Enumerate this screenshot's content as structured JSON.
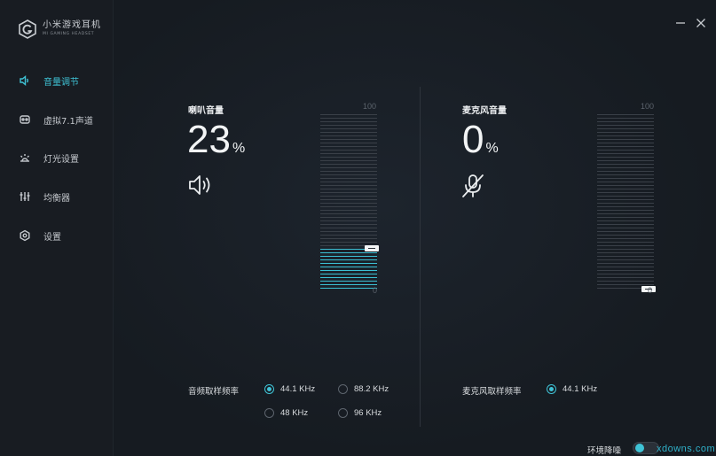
{
  "brand": {
    "name": "小米游戏耳机",
    "subtitle": "MI GAMING HEADSET"
  },
  "sidebar": {
    "items": [
      {
        "label": "音量调节",
        "icon": "speaker-icon",
        "active": true
      },
      {
        "label": "虚拟7.1声道",
        "icon": "virtual-surround-icon",
        "active": false
      },
      {
        "label": "灯光设置",
        "icon": "light-icon",
        "active": false
      },
      {
        "label": "均衡器",
        "icon": "equalizer-icon",
        "active": false
      },
      {
        "label": "设置",
        "icon": "settings-icon",
        "active": false
      }
    ]
  },
  "window": {
    "minimize_icon": "minimize-icon",
    "close_icon": "close-icon"
  },
  "speaker": {
    "title": "喇叭音量",
    "value": "23",
    "unit": "%",
    "level": 0.23,
    "icon": "speaker-volume-icon",
    "scale_max": "100",
    "scale_min": "0"
  },
  "mic": {
    "title": "麦克风音量",
    "value": "0",
    "unit": "%",
    "level": 0,
    "icon": "mic-muted-icon",
    "scale_max": "100",
    "scale_min": "0"
  },
  "speaker_sample_rate": {
    "label": "音频取样频率",
    "options": [
      {
        "label": "44.1 KHz",
        "checked": true
      },
      {
        "label": "88.2 KHz",
        "checked": false
      },
      {
        "label": "48 KHz",
        "checked": false
      },
      {
        "label": "96 KHz",
        "checked": false
      }
    ]
  },
  "mic_sample_rate": {
    "label": "麦克风取样频率",
    "options": [
      {
        "label": "44.1 KHz",
        "checked": true
      }
    ]
  },
  "footer": {
    "noise_label": "环境降噪",
    "noise_enabled": true,
    "watermark": "xdowns.com"
  },
  "colors": {
    "accent": "#3fc3d6",
    "background": "#15191f",
    "sidebar": "#181c22"
  }
}
